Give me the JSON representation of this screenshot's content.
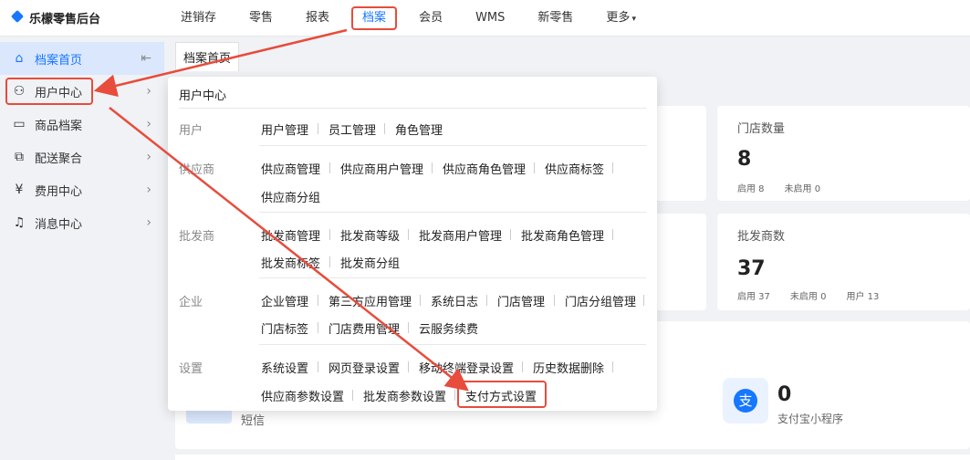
{
  "app": {
    "title": "乐檬零售后台"
  },
  "topnav": [
    "进销存",
    "零售",
    "报表",
    "档案",
    "会员",
    "WMS",
    "新零售",
    "更多"
  ],
  "sidebar": {
    "items": [
      {
        "label": "档案首页",
        "icon": "home-icon"
      },
      {
        "label": "用户中心",
        "icon": "user-icon"
      },
      {
        "label": "商品档案",
        "icon": "product-icon"
      },
      {
        "label": "配送聚合",
        "icon": "delivery-icon"
      },
      {
        "label": "费用中心",
        "icon": "yen-icon"
      },
      {
        "label": "消息中心",
        "icon": "bell-icon"
      }
    ]
  },
  "tab": {
    "label": "档案首页"
  },
  "stats": {
    "store": {
      "label": "门店数量",
      "value": "8",
      "enabled": "启用 8",
      "disabled": "未启用 0"
    },
    "wholesaler": {
      "label": "批发商数",
      "value": "37",
      "enabled": "启用 37",
      "disabled": "未启用 0",
      "users": "用户 13"
    },
    "sms": {
      "label": "短信"
    },
    "alipay": {
      "label": "支付宝小程序",
      "value": "0",
      "icon_glyph": "支"
    }
  },
  "dropdown": {
    "title": "用户中心",
    "sections": [
      {
        "name": "用户",
        "links": [
          "用户管理",
          "员工管理",
          "角色管理"
        ]
      },
      {
        "name": "供应商",
        "links": [
          "供应商管理",
          "供应商用户管理",
          "供应商角色管理",
          "供应商标签",
          "供应商分组"
        ]
      },
      {
        "name": "批发商",
        "links": [
          "批发商管理",
          "批发商等级",
          "批发商用户管理",
          "批发商角色管理",
          "批发商标签",
          "批发商分组"
        ]
      },
      {
        "name": "企业",
        "links": [
          "企业管理",
          "第三方应用管理",
          "系统日志",
          "门店管理",
          "门店分组管理",
          "门店标签",
          "门店费用管理",
          "云服务续费"
        ]
      },
      {
        "name": "设置",
        "links": [
          "系统设置",
          "网页登录设置",
          "移动终端登录设置",
          "历史数据删除",
          "供应商参数设置",
          "批发商参数设置",
          "支付方式设置"
        ]
      }
    ]
  },
  "colors": {
    "accent": "#1677ff",
    "annotation": "#e74c3c"
  }
}
